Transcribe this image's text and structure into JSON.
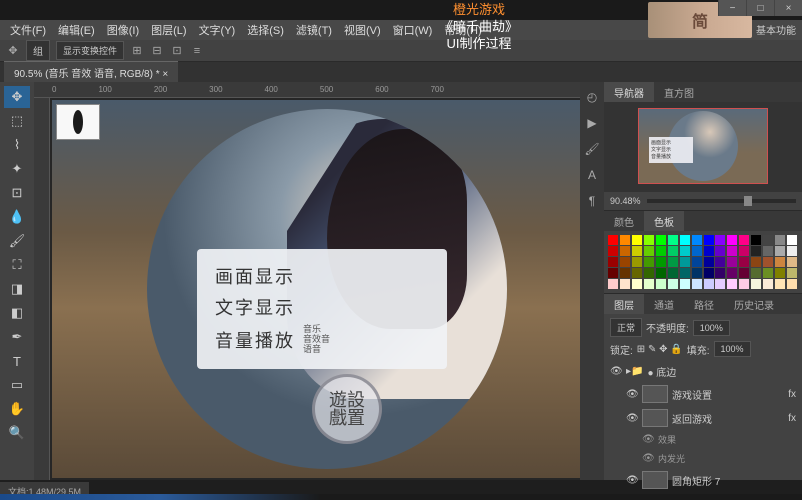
{
  "overlay": {
    "line1": "橙光游戏",
    "line2": "《暗千曲劫》",
    "line3": "UI制作过程",
    "banner": "简"
  },
  "window": {
    "minimize": "−",
    "maximize": "□",
    "close": "×",
    "right_label": "基本功能"
  },
  "menu": {
    "items": [
      "文件(F)",
      "编辑(E)",
      "图像(I)",
      "图层(L)",
      "文字(Y)",
      "选择(S)",
      "滤镜(T)",
      "视图(V)",
      "窗口(W)",
      "帮助(H)"
    ]
  },
  "options": {
    "mode": "组",
    "toggle": "显示变换控件"
  },
  "document": {
    "tab": "90.5% (音乐 音效 语音, RGB/8) * ×",
    "ruler_marks": [
      "0",
      "100",
      "200",
      "300",
      "400",
      "500",
      "600",
      "700"
    ]
  },
  "ui_menu": {
    "item1": "画面显示",
    "item2": "文字显示",
    "item3": "音量播放",
    "sub1": "音乐",
    "sub2": "音效音",
    "sub3": "语音",
    "seal_top": "遊設",
    "seal_bottom": "戲置"
  },
  "panels": {
    "nav": {
      "tab1": "导航器",
      "tab2": "直方图",
      "zoom": "90.48%"
    },
    "color": {
      "tab1": "颜色",
      "tab2": "色板"
    },
    "layers": {
      "tab1": "图层",
      "tab2": "通道",
      "tab3": "路径",
      "tab4": "历史记录",
      "blend": "正常",
      "opacity_label": "不透明度:",
      "opacity": "100%",
      "fill_label": "填充:",
      "fill": "100%",
      "lock": "锁定:",
      "group": "● 底边",
      "layer1": "游戏设置",
      "layer2": "返回游戏",
      "fx": "效果",
      "fx_item": "内发光",
      "layer3": "圆角矩形 7"
    }
  },
  "status": {
    "left": "文档:1.48M/29.5M"
  },
  "swatch_colors": [
    "#ff0000",
    "#ff8800",
    "#ffff00",
    "#88ff00",
    "#00ff00",
    "#00ff88",
    "#00ffff",
    "#0088ff",
    "#0000ff",
    "#8800ff",
    "#ff00ff",
    "#ff0088",
    "#000000",
    "#444444",
    "#888888",
    "#ffffff",
    "#cc0000",
    "#cc6600",
    "#cccc00",
    "#66cc00",
    "#00cc00",
    "#00cc66",
    "#00cccc",
    "#0066cc",
    "#0000cc",
    "#6600cc",
    "#cc00cc",
    "#cc0066",
    "#222222",
    "#666666",
    "#aaaaaa",
    "#eeeeee",
    "#990000",
    "#994400",
    "#999900",
    "#449900",
    "#009900",
    "#009944",
    "#009999",
    "#004499",
    "#000099",
    "#440099",
    "#990099",
    "#990044",
    "#8b4513",
    "#a0522d",
    "#cd853f",
    "#deb887",
    "#660000",
    "#663300",
    "#666600",
    "#336600",
    "#006600",
    "#006633",
    "#006666",
    "#003366",
    "#000066",
    "#330066",
    "#660066",
    "#660033",
    "#556b2f",
    "#6b8e23",
    "#808000",
    "#bdb76b",
    "#ffcccc",
    "#ffe4cc",
    "#ffffcc",
    "#e4ffcc",
    "#ccffcc",
    "#ccffe4",
    "#ccffff",
    "#cce4ff",
    "#ccccff",
    "#e4ccff",
    "#ffccff",
    "#ffcce4",
    "#f5f5dc",
    "#faebd7",
    "#ffe4b5",
    "#ffdead"
  ]
}
